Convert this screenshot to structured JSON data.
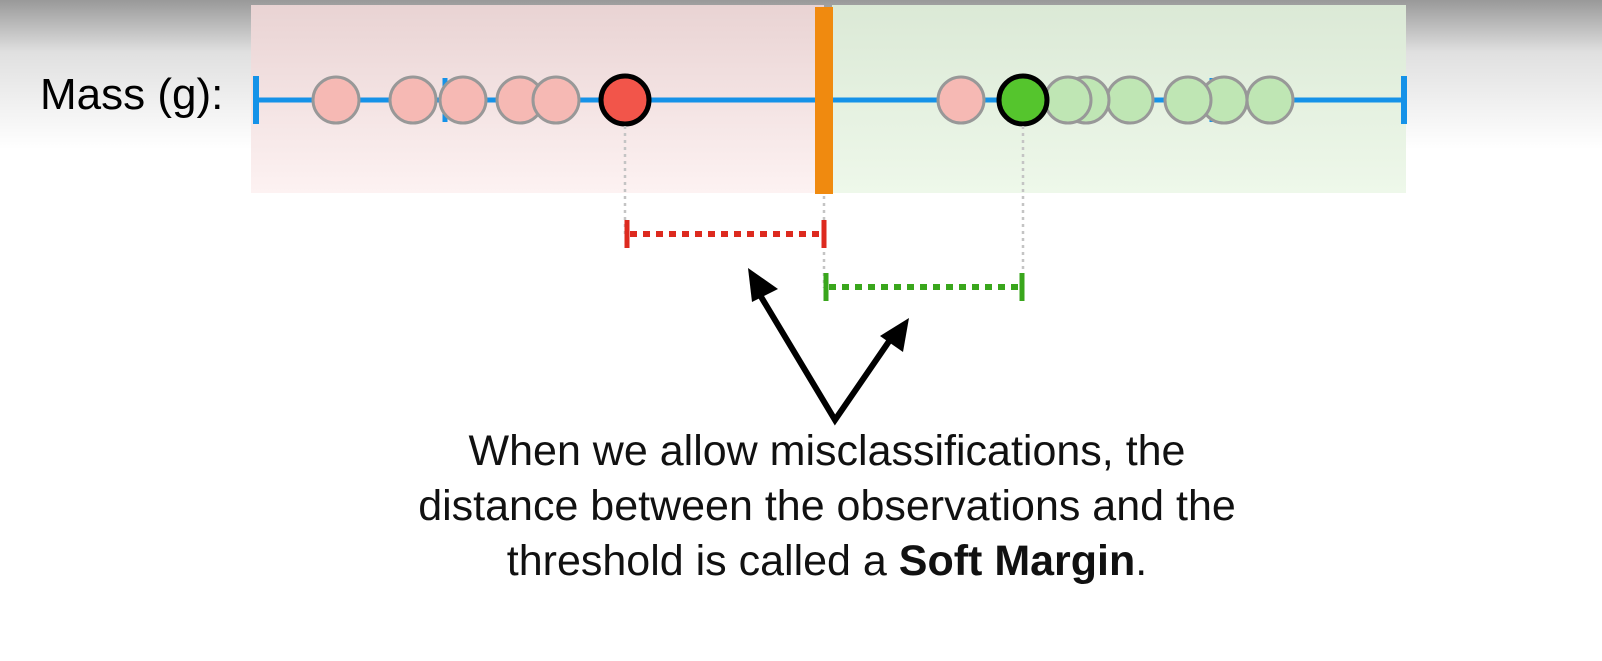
{
  "axis": {
    "label": "Mass (g):"
  },
  "caption": {
    "line1": "When we allow misclassifications, the",
    "line2": "distance between the observations and the",
    "line3_prefix": "threshold is called a ",
    "line3_bold": "Soft Margin",
    "line3_suffix": "."
  },
  "colors": {
    "axis_line": "#1592e8",
    "threshold": "#f08a0f",
    "red_region": "#f6dada",
    "green_region": "#e4f3df",
    "red_point": "#f6b9b4",
    "green_point": "#bfe6b4",
    "red_highlight": "#f2554a",
    "green_highlight": "#55c52d",
    "red_margin": "#dd2a1f",
    "green_margin": "#39a61c"
  },
  "observations": {
    "red": [
      "red",
      "red",
      "red",
      "red",
      "red",
      "red",
      "red-highlight"
    ],
    "green": [
      "red",
      "green-highlight",
      "green",
      "green",
      "green",
      "green",
      "green"
    ]
  },
  "icons": [
    "arrow-icon"
  ]
}
